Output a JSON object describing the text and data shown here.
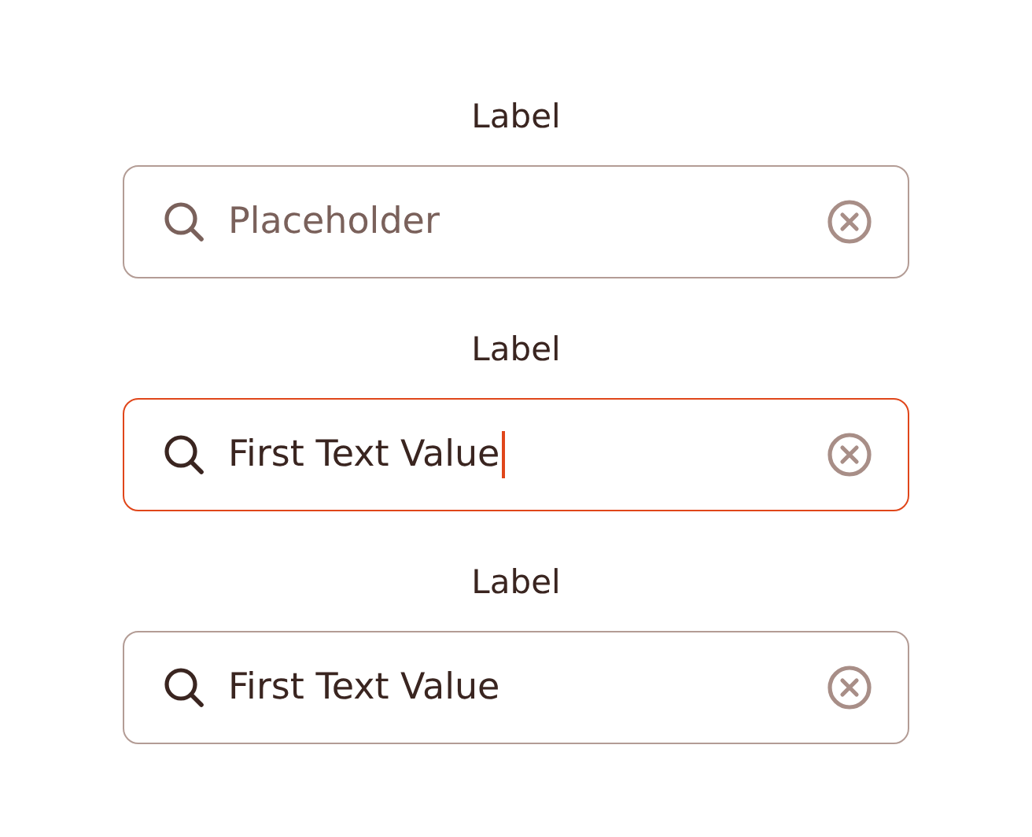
{
  "fields": [
    {
      "label": "Label",
      "placeholder": "Placeholder",
      "focused": false
    },
    {
      "label": "Label",
      "value": "First Text Value",
      "focused": true
    },
    {
      "label": "Label",
      "value": "First Text Value",
      "focused": false
    }
  ]
}
